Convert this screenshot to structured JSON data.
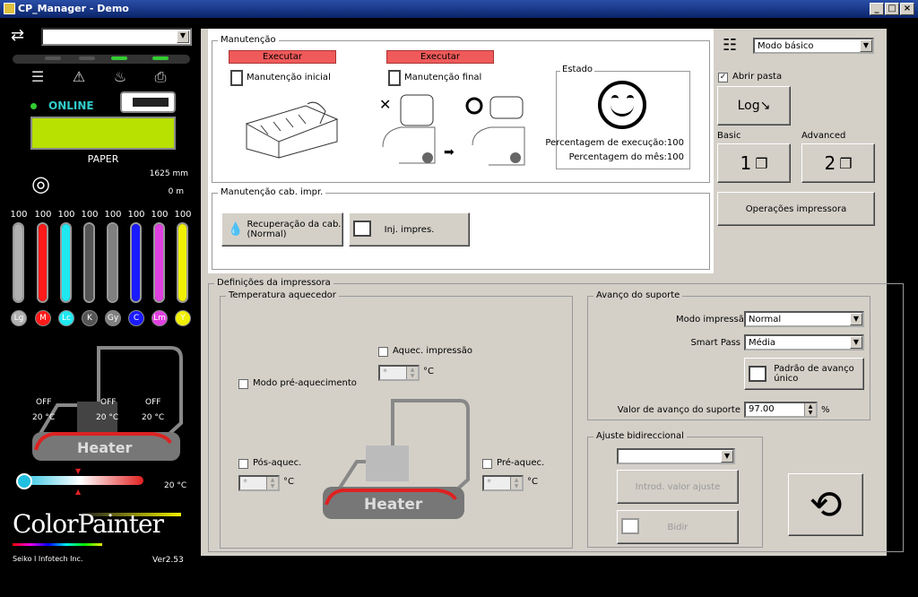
{
  "window": {
    "title": "CP_Manager - Demo",
    "min": "_",
    "max": "□",
    "close": "×"
  },
  "left": {
    "printer_select": "",
    "status": "ONLINE",
    "media_label": "PAPER",
    "media_length": "1625 mm",
    "media_remaining": "0 m",
    "inks": [
      {
        "pct": "100",
        "code": "Lg",
        "color": "#b0b0b0",
        "level": 1.0
      },
      {
        "pct": "100",
        "code": "M",
        "color": "#ff1a1a",
        "level": 1.0
      },
      {
        "pct": "100",
        "code": "Lc",
        "color": "#20e8f0",
        "level": 1.0
      },
      {
        "pct": "100",
        "code": "K",
        "color": "#555555",
        "level": 1.0
      },
      {
        "pct": "100",
        "code": "Gy",
        "color": "#808080",
        "level": 1.0
      },
      {
        "pct": "100",
        "code": "C",
        "color": "#1a1aff",
        "level": 1.0
      },
      {
        "pct": "100",
        "code": "Lm",
        "color": "#e040e0",
        "level": 1.0
      },
      {
        "pct": "100",
        "code": "Y",
        "color": "#f0f000",
        "level": 1.0
      }
    ],
    "heater": {
      "label": "Heater",
      "zones": [
        {
          "state": "OFF",
          "temp": "20 °C"
        },
        {
          "state": "OFF",
          "temp": "20 °C"
        },
        {
          "state": "OFF",
          "temp": "20 °C"
        }
      ],
      "ambient": "20 °C"
    },
    "brand": {
      "name": "ColorPainter",
      "company": "Seiko I Infotech Inc.",
      "version": "Ver2.53"
    }
  },
  "maint": {
    "title": "Manutenção",
    "exec1": "Executar",
    "label1": "Manutenção inicial",
    "exec2": "Executar",
    "label2": "Manutenção final",
    "state_title": "Estado",
    "exec_pct": "Percentagem de execução:100",
    "month_pct": "Percentagem do mês:100"
  },
  "head": {
    "title": "Manutenção cab. impr.",
    "recovery": "Recuperação da cab.\n(Normal)",
    "inject": "Inj. impres."
  },
  "right": {
    "mode": "Modo básico",
    "open_folder": "Abrir pasta",
    "log": "Log",
    "basic": "Basic",
    "advanced": "Advanced",
    "basic_num": "1",
    "adv_num": "2",
    "ops": "Operações impressora"
  },
  "settings": {
    "title": "Definições da impressora",
    "temp_title": "Temperatura aquecedor",
    "print_heat": "Aquec. impressão",
    "preheat_mode": "Modo pré-aquecimento",
    "post_heat": "Pós-aquec.",
    "pre_heat": "Pré-aquec.",
    "unit": "°C",
    "spin_val": "*",
    "heater_label": "Heater",
    "feed_title": "Avanço do suporte",
    "print_mode_lbl": "Modo impressão",
    "print_mode": "Normal",
    "smart_pass_lbl": "Smart Pass",
    "smart_pass": "Média",
    "single_feed": "Padrão de avanço\núnico",
    "feed_val_lbl": "Valor de avanço do suporte",
    "feed_val": "97.00",
    "pct": "%",
    "bidir_title": "Ajuste bidireccional",
    "bidir_select": "",
    "enter_adj": "Introd. valor ajuste",
    "bidir": "Bidir"
  }
}
